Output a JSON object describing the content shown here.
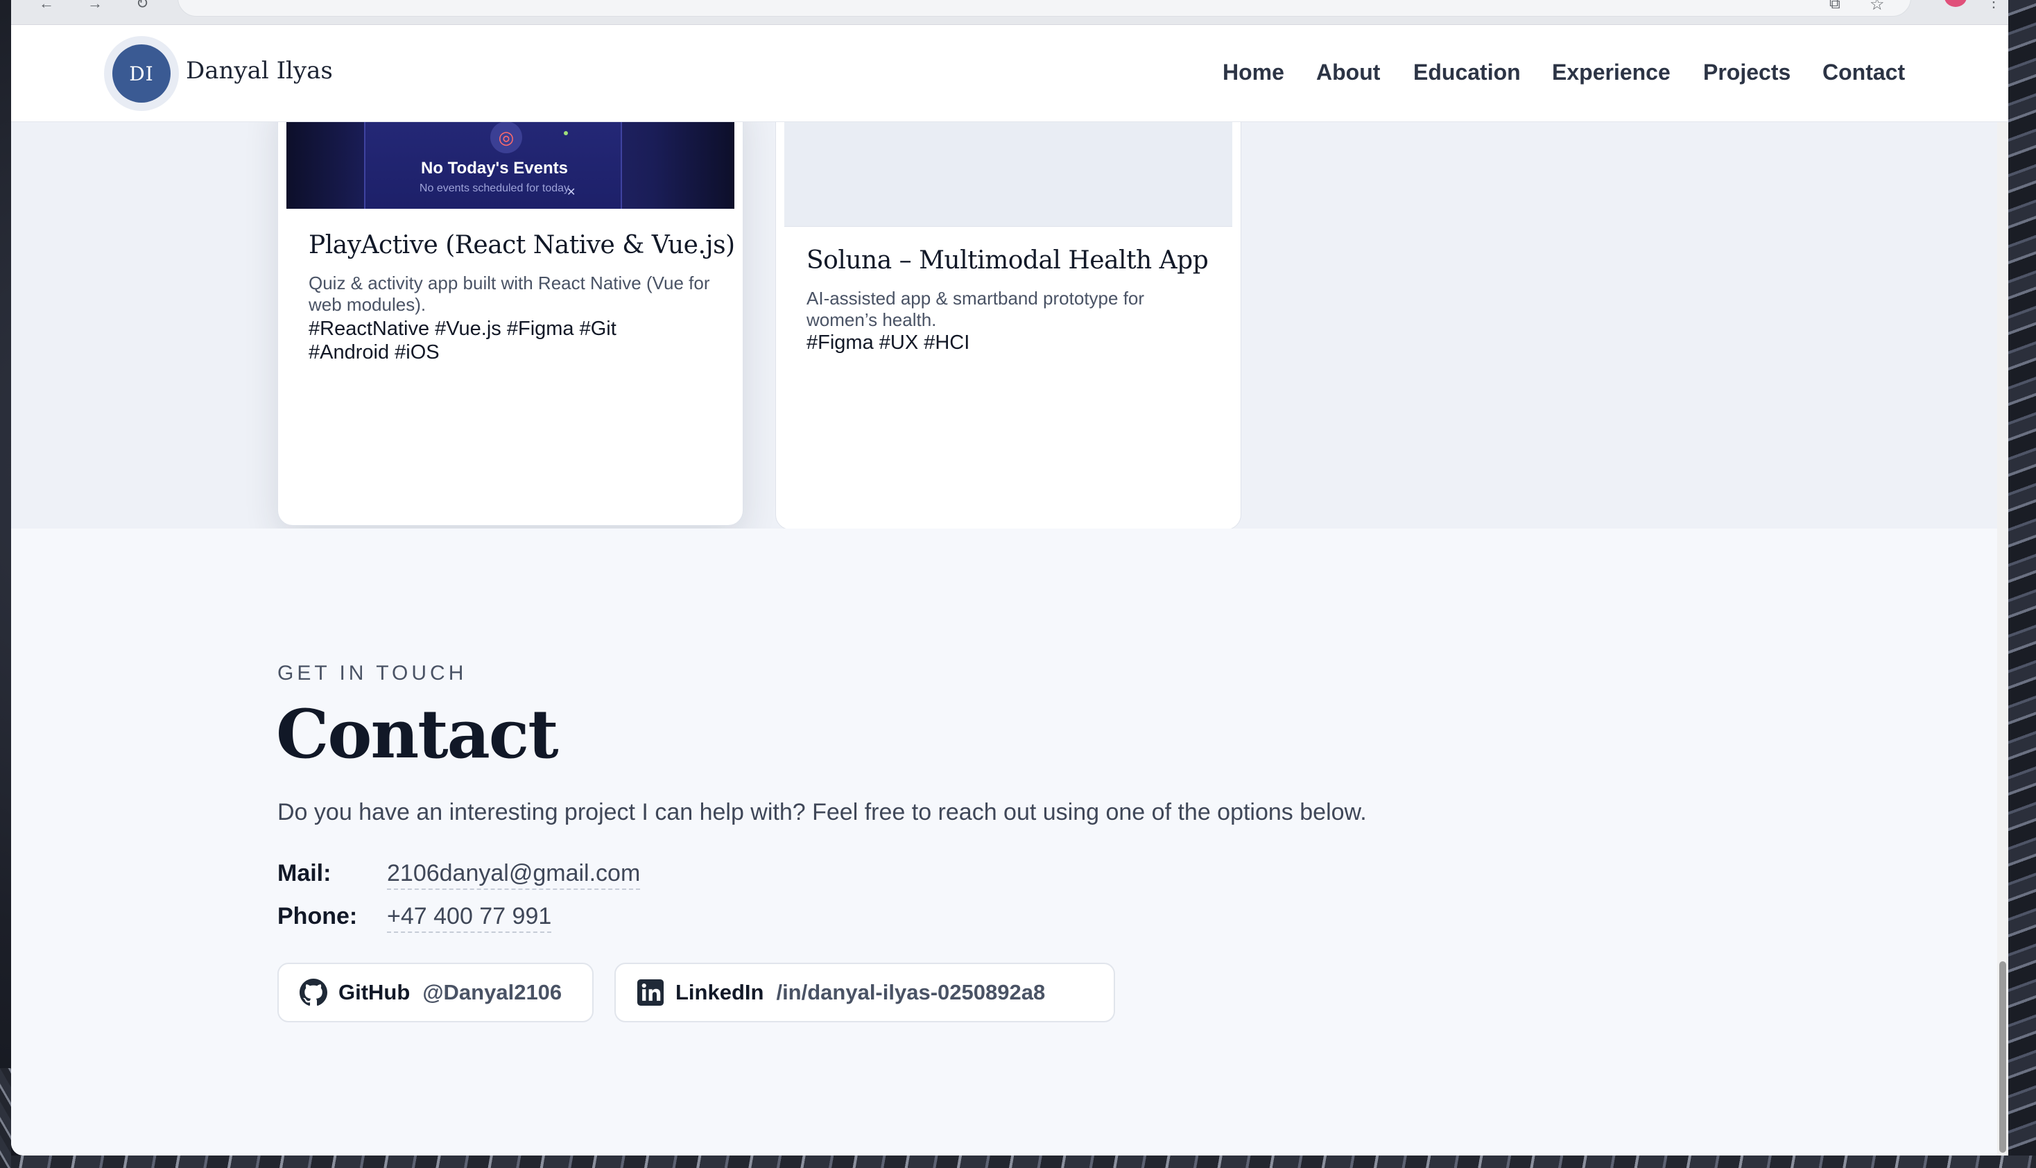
{
  "site": {
    "logo_initials": "DI",
    "brand_name": "Danyal Ilyas"
  },
  "nav": {
    "items": [
      {
        "label": "Home"
      },
      {
        "label": "About"
      },
      {
        "label": "Education"
      },
      {
        "label": "Experience"
      },
      {
        "label": "Projects"
      },
      {
        "label": "Contact"
      }
    ]
  },
  "projects": {
    "cards": [
      {
        "title": "PlayActive (React Native & Vue.js)",
        "description": "Quiz & activity app built with React Native (Vue for web modules).",
        "tags": "#ReactNative #Vue.js #Figma #Git #Android #iOS",
        "screenshot_text": "No Today's Events",
        "screenshot_subtext": "No events scheduled for today"
      },
      {
        "title": "Soluna – Multimodal Health App",
        "description": "AI-assisted app & smartband prototype for women’s health.",
        "tags": "#Figma #UX #HCI"
      }
    ]
  },
  "contact": {
    "eyebrow": "GET IN TOUCH",
    "title": "Contact",
    "intro": "Do you have an interesting project I can help with? Feel free to reach out using one of the options below.",
    "mail_label": "Mail:",
    "mail_value": "2106danyal@gmail.com",
    "phone_label": "Phone:",
    "phone_value": "+47 400 77 991",
    "github": {
      "name": "GitHub",
      "handle": "@Danyal2106",
      "icon": "github-icon"
    },
    "linkedin": {
      "name": "LinkedIn",
      "handle": "/in/danyal-ilyas-0250892a8",
      "icon": "linkedin-icon"
    }
  },
  "colors": {
    "accent": "#3a5a93",
    "text_dark": "#111827",
    "text_muted": "#4a5365"
  }
}
